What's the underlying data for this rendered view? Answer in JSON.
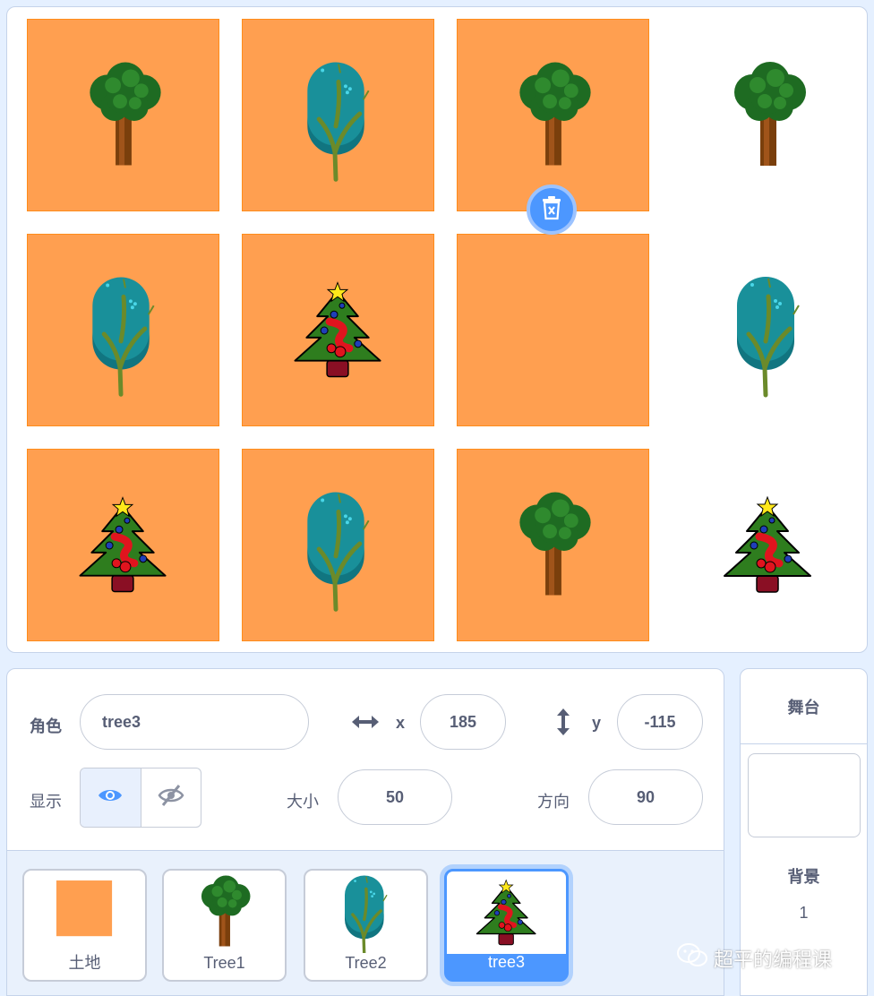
{
  "stage": {
    "cells": [
      {
        "land": true,
        "tree": "leafy"
      },
      {
        "land": true,
        "tree": "teal"
      },
      {
        "land": true,
        "tree": "leafy"
      },
      {
        "land": false,
        "tree": "leafy"
      },
      {
        "land": true,
        "tree": "teal"
      },
      {
        "land": true,
        "tree": "xmas"
      },
      {
        "land": true,
        "tree": "none"
      },
      {
        "land": false,
        "tree": "teal"
      },
      {
        "land": true,
        "tree": "xmas"
      },
      {
        "land": true,
        "tree": "teal"
      },
      {
        "land": true,
        "tree": "leafy"
      },
      {
        "land": false,
        "tree": "xmas"
      }
    ]
  },
  "sprite_info": {
    "sprite_label": "角色",
    "sprite_name": "tree3",
    "x_label": "x",
    "x_value": "185",
    "y_label": "y",
    "y_value": "-115",
    "show_label": "显示",
    "size_label": "大小",
    "size_value": "50",
    "direction_label": "方向",
    "direction_value": "90"
  },
  "sprites": [
    {
      "name": "土地",
      "thumb": "land"
    },
    {
      "name": "Tree1",
      "thumb": "leafy"
    },
    {
      "name": "Tree2",
      "thumb": "teal"
    },
    {
      "name": "tree3",
      "thumb": "xmas",
      "selected": true
    }
  ],
  "stage_panel": {
    "title": "舞台",
    "backdrop_label": "背景",
    "backdrop_count": "1"
  },
  "watermark": "超平的编程课",
  "colors": {
    "land": "#ff9f50",
    "accent": "#4c97ff",
    "text": "#575e75"
  }
}
